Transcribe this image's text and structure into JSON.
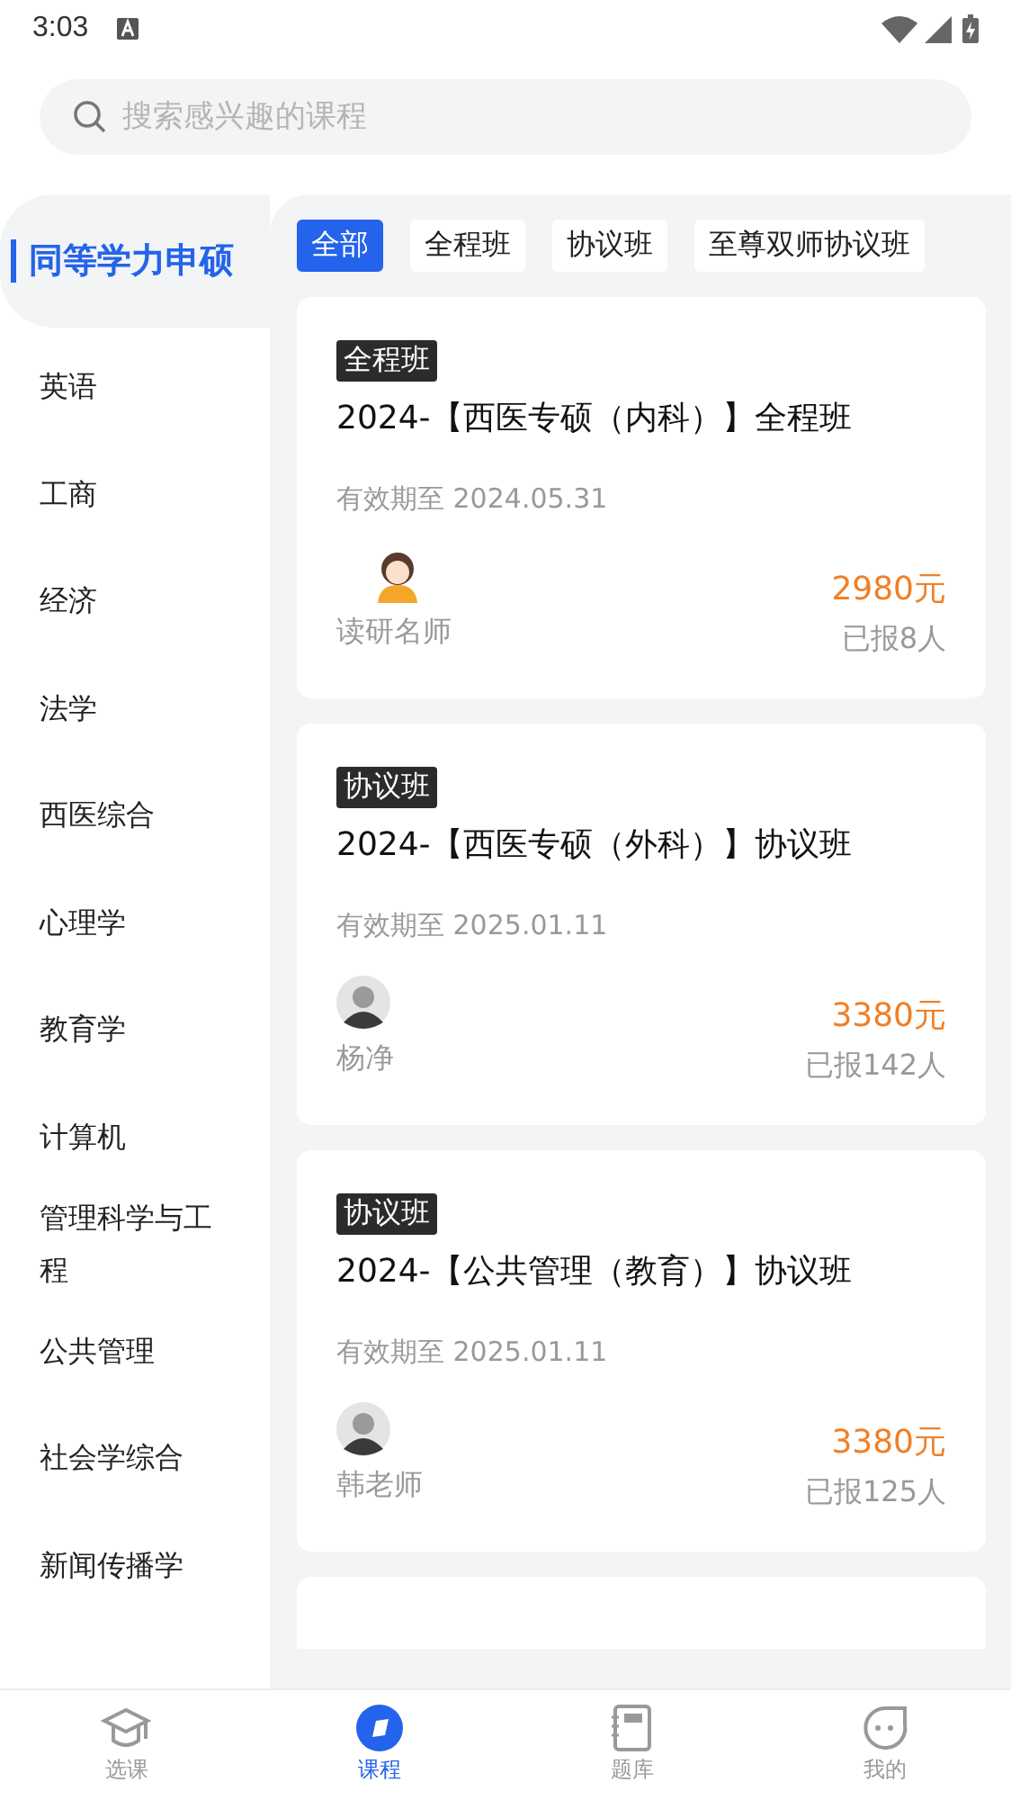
{
  "status_bar": {
    "time": "3:03"
  },
  "search": {
    "placeholder": "搜索感兴趣的课程"
  },
  "sidebar": {
    "items": [
      {
        "label": "同等学力申硕",
        "selected": true
      },
      {
        "label": "英语",
        "selected": false
      },
      {
        "label": "工商",
        "selected": false
      },
      {
        "label": "经济",
        "selected": false
      },
      {
        "label": "法学",
        "selected": false
      },
      {
        "label": "西医综合",
        "selected": false
      },
      {
        "label": "心理学",
        "selected": false
      },
      {
        "label": "教育学",
        "selected": false
      },
      {
        "label": "计算机",
        "selected": false
      },
      {
        "label": "管理科学与工程",
        "selected": false
      },
      {
        "label": "公共管理",
        "selected": false
      },
      {
        "label": "社会学综合",
        "selected": false
      },
      {
        "label": "新闻传播学",
        "selected": false
      }
    ]
  },
  "filters": [
    {
      "label": "全部",
      "selected": true
    },
    {
      "label": "全程班",
      "selected": false
    },
    {
      "label": "协议班",
      "selected": false
    },
    {
      "label": "至尊双师协议班",
      "selected": false
    }
  ],
  "courses": [
    {
      "tag": "全程班",
      "title": "2024-【西医专硕（内科）】全程班",
      "validity": "有效期至 2024.05.31",
      "teacher": "读研名师",
      "kind": "cartoon",
      "price": "2980元",
      "enrolled": "已报8人"
    },
    {
      "tag": "协议班",
      "title": "2024-【西医专硕（外科）】协议班",
      "validity": "有效期至 2025.01.11",
      "teacher": "杨净",
      "kind": "photo",
      "price": "3380元",
      "enrolled": "已报142人"
    },
    {
      "tag": "协议班",
      "title": "2024-【公共管理（教育）】协议班",
      "validity": "有效期至 2025.01.11",
      "teacher": "韩老师",
      "kind": "photo",
      "price": "3380元",
      "enrolled": "已报125人"
    }
  ],
  "bottom_nav": [
    {
      "label": "选课",
      "selected": false
    },
    {
      "label": "课程",
      "selected": true
    },
    {
      "label": "题库",
      "selected": false
    },
    {
      "label": "我的",
      "selected": false
    }
  ]
}
